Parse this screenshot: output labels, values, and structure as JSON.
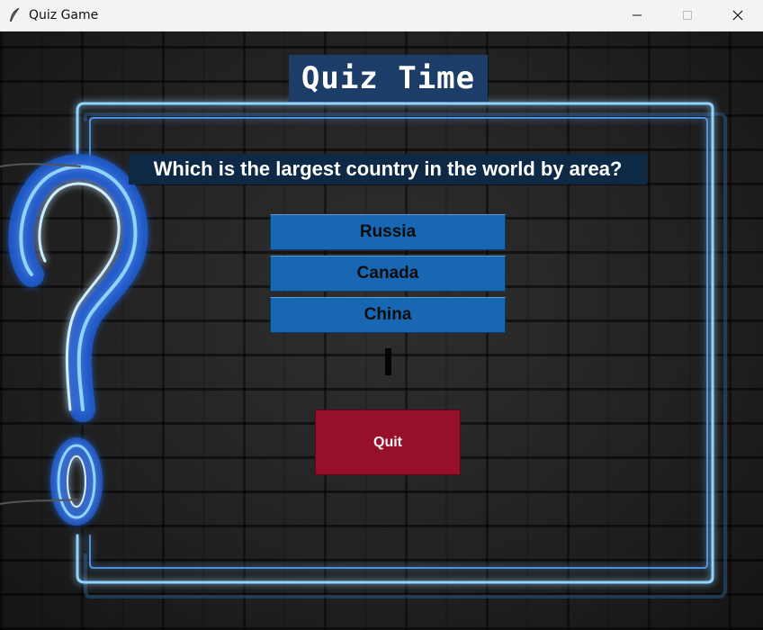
{
  "window": {
    "title": "Quiz Game",
    "app_icon": "feather-icon",
    "controls": {
      "minimize_icon": "minimize-icon",
      "maximize_icon": "maximize-icon",
      "close_icon": "close-icon"
    }
  },
  "quiz": {
    "title": "Quiz Time",
    "question": "Which is the largest country in the world by area?",
    "answers": [
      {
        "label": "Russia"
      },
      {
        "label": "Canada"
      },
      {
        "label": "China"
      }
    ],
    "feedback": "",
    "quit_label": "Quit"
  },
  "colors": {
    "title_bg": "#1c3d68",
    "question_bg": "#0d2946",
    "answer_bg": "#1767b3",
    "quit_bg": "#961029",
    "neon": "#8fd3ff"
  }
}
